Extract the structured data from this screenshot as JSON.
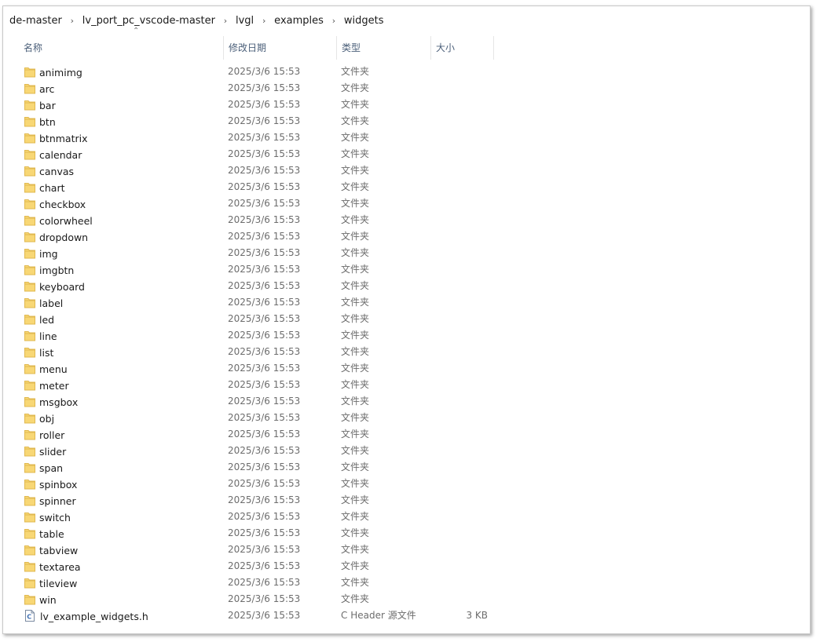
{
  "breadcrumb": [
    "de-master",
    "lv_port_pc_vscode-master",
    "lvgl",
    "examples",
    "widgets"
  ],
  "columns": {
    "name": "名称",
    "date": "修改日期",
    "type": "类型",
    "size": "大小"
  },
  "colors": {
    "folder": "#f8d775",
    "header_text": "#4c607a",
    "meta_text": "#6d6d6d"
  },
  "files": [
    {
      "name": "animimg",
      "date": "2025/3/6 15:53",
      "type": "文件夹",
      "size": "",
      "icon": "folder-icon"
    },
    {
      "name": "arc",
      "date": "2025/3/6 15:53",
      "type": "文件夹",
      "size": "",
      "icon": "folder-icon"
    },
    {
      "name": "bar",
      "date": "2025/3/6 15:53",
      "type": "文件夹",
      "size": "",
      "icon": "folder-icon"
    },
    {
      "name": "btn",
      "date": "2025/3/6 15:53",
      "type": "文件夹",
      "size": "",
      "icon": "folder-icon"
    },
    {
      "name": "btnmatrix",
      "date": "2025/3/6 15:53",
      "type": "文件夹",
      "size": "",
      "icon": "folder-icon"
    },
    {
      "name": "calendar",
      "date": "2025/3/6 15:53",
      "type": "文件夹",
      "size": "",
      "icon": "folder-icon"
    },
    {
      "name": "canvas",
      "date": "2025/3/6 15:53",
      "type": "文件夹",
      "size": "",
      "icon": "folder-icon"
    },
    {
      "name": "chart",
      "date": "2025/3/6 15:53",
      "type": "文件夹",
      "size": "",
      "icon": "folder-icon"
    },
    {
      "name": "checkbox",
      "date": "2025/3/6 15:53",
      "type": "文件夹",
      "size": "",
      "icon": "folder-icon"
    },
    {
      "name": "colorwheel",
      "date": "2025/3/6 15:53",
      "type": "文件夹",
      "size": "",
      "icon": "folder-icon"
    },
    {
      "name": "dropdown",
      "date": "2025/3/6 15:53",
      "type": "文件夹",
      "size": "",
      "icon": "folder-icon"
    },
    {
      "name": "img",
      "date": "2025/3/6 15:53",
      "type": "文件夹",
      "size": "",
      "icon": "folder-icon"
    },
    {
      "name": "imgbtn",
      "date": "2025/3/6 15:53",
      "type": "文件夹",
      "size": "",
      "icon": "folder-icon"
    },
    {
      "name": "keyboard",
      "date": "2025/3/6 15:53",
      "type": "文件夹",
      "size": "",
      "icon": "folder-icon"
    },
    {
      "name": "label",
      "date": "2025/3/6 15:53",
      "type": "文件夹",
      "size": "",
      "icon": "folder-icon"
    },
    {
      "name": "led",
      "date": "2025/3/6 15:53",
      "type": "文件夹",
      "size": "",
      "icon": "folder-icon"
    },
    {
      "name": "line",
      "date": "2025/3/6 15:53",
      "type": "文件夹",
      "size": "",
      "icon": "folder-icon"
    },
    {
      "name": "list",
      "date": "2025/3/6 15:53",
      "type": "文件夹",
      "size": "",
      "icon": "folder-icon"
    },
    {
      "name": "menu",
      "date": "2025/3/6 15:53",
      "type": "文件夹",
      "size": "",
      "icon": "folder-icon"
    },
    {
      "name": "meter",
      "date": "2025/3/6 15:53",
      "type": "文件夹",
      "size": "",
      "icon": "folder-icon"
    },
    {
      "name": "msgbox",
      "date": "2025/3/6 15:53",
      "type": "文件夹",
      "size": "",
      "icon": "folder-icon"
    },
    {
      "name": "obj",
      "date": "2025/3/6 15:53",
      "type": "文件夹",
      "size": "",
      "icon": "folder-icon"
    },
    {
      "name": "roller",
      "date": "2025/3/6 15:53",
      "type": "文件夹",
      "size": "",
      "icon": "folder-icon"
    },
    {
      "name": "slider",
      "date": "2025/3/6 15:53",
      "type": "文件夹",
      "size": "",
      "icon": "folder-icon"
    },
    {
      "name": "span",
      "date": "2025/3/6 15:53",
      "type": "文件夹",
      "size": "",
      "icon": "folder-icon"
    },
    {
      "name": "spinbox",
      "date": "2025/3/6 15:53",
      "type": "文件夹",
      "size": "",
      "icon": "folder-icon"
    },
    {
      "name": "spinner",
      "date": "2025/3/6 15:53",
      "type": "文件夹",
      "size": "",
      "icon": "folder-icon"
    },
    {
      "name": "switch",
      "date": "2025/3/6 15:53",
      "type": "文件夹",
      "size": "",
      "icon": "folder-icon"
    },
    {
      "name": "table",
      "date": "2025/3/6 15:53",
      "type": "文件夹",
      "size": "",
      "icon": "folder-icon"
    },
    {
      "name": "tabview",
      "date": "2025/3/6 15:53",
      "type": "文件夹",
      "size": "",
      "icon": "folder-icon"
    },
    {
      "name": "textarea",
      "date": "2025/3/6 15:53",
      "type": "文件夹",
      "size": "",
      "icon": "folder-icon"
    },
    {
      "name": "tileview",
      "date": "2025/3/6 15:53",
      "type": "文件夹",
      "size": "",
      "icon": "folder-icon"
    },
    {
      "name": "win",
      "date": "2025/3/6 15:53",
      "type": "文件夹",
      "size": "",
      "icon": "folder-icon"
    },
    {
      "name": "lv_example_widgets.h",
      "date": "2025/3/6 15:53",
      "type": "C Header 源文件",
      "size": "3 KB",
      "icon": "c-header-file-icon"
    }
  ]
}
